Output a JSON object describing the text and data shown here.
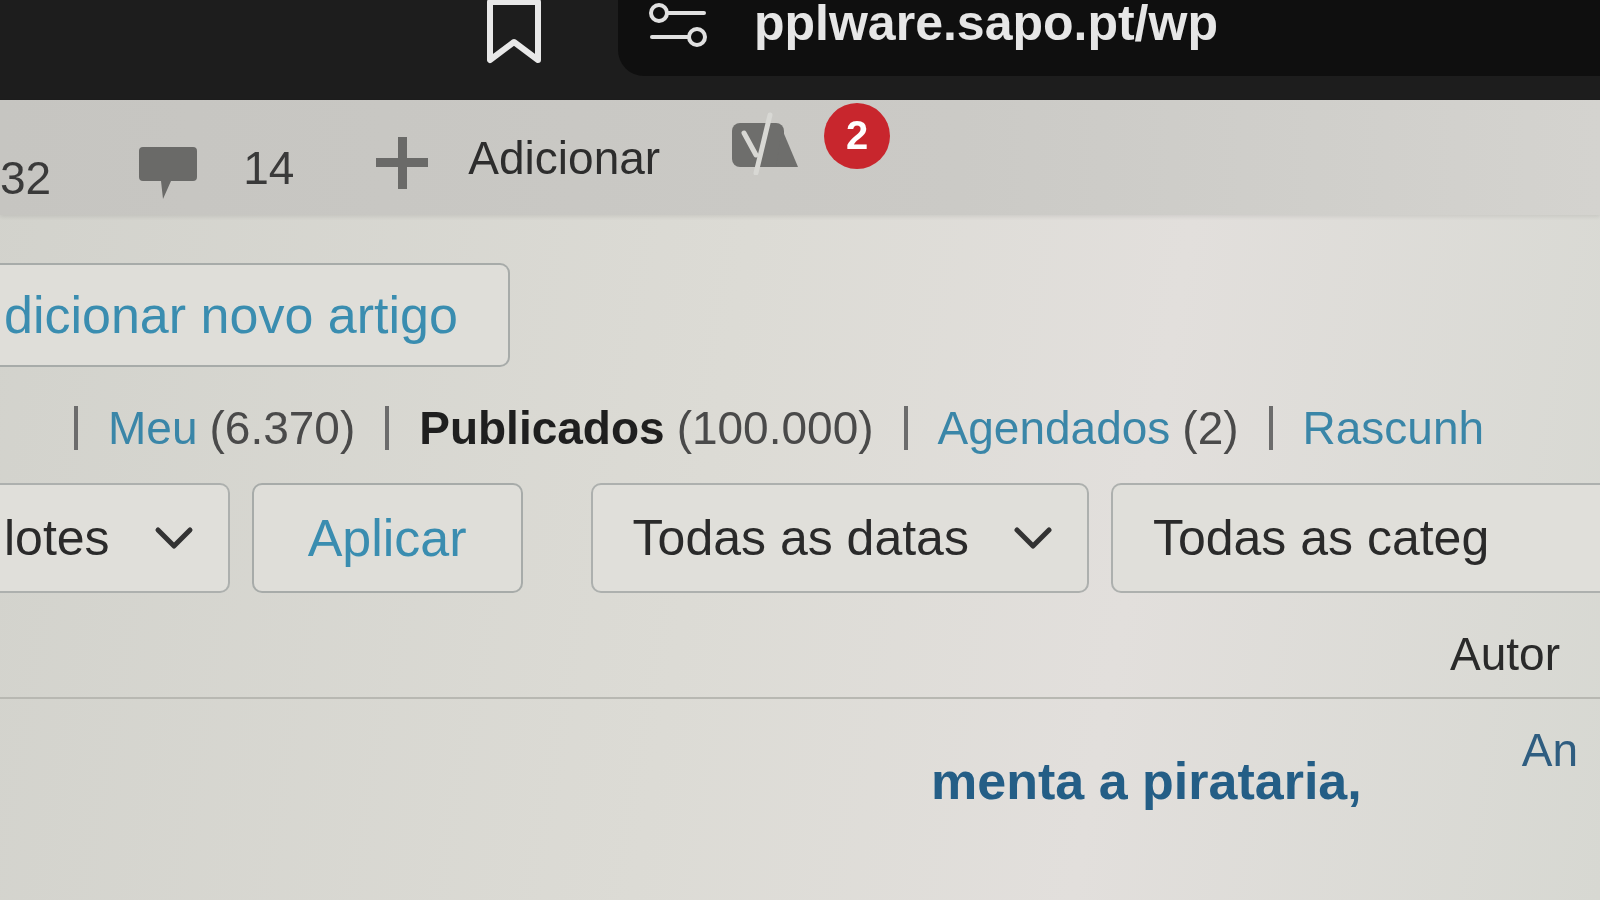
{
  "browser": {
    "address": "pplware.sapo.pt/wp"
  },
  "admin_bar": {
    "updates_count": "32",
    "comments_count": "14",
    "new_label": "Adicionar",
    "badge": "2"
  },
  "add_button": "dicionar novo artigo",
  "views": [
    {
      "label": "Meu",
      "count": "(6.370)",
      "selected": false
    },
    {
      "label": "Publicados",
      "count": "(100.000)",
      "selected": true
    },
    {
      "label": "Agendados",
      "count": "(2)",
      "selected": false
    },
    {
      "label": "Rascunh",
      "selected": false
    }
  ],
  "filters": {
    "bulk_action": "lotes",
    "apply": "Aplicar",
    "dates": "Todas as datas",
    "categories": "Todas as categ"
  },
  "table": {
    "header": {
      "author": "Autor"
    },
    "rows": [
      {
        "column_1": "menta a pirataria,",
        "author": "An"
      }
    ]
  }
}
